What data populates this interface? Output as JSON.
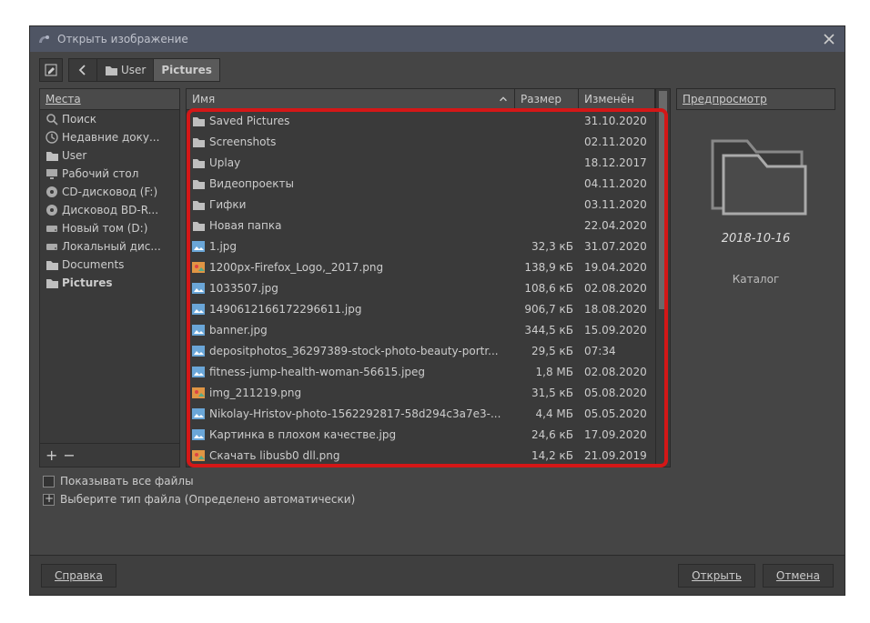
{
  "window": {
    "title": "Открыть изображение"
  },
  "breadcrumb": {
    "back": "<",
    "folder_icon": "folder",
    "segs": [
      "User",
      "Pictures"
    ]
  },
  "places": {
    "header": "Места",
    "items": [
      {
        "icon": "search",
        "label": "Поиск"
      },
      {
        "icon": "recent",
        "label": "Недавние доку..."
      },
      {
        "icon": "folder",
        "label": "User"
      },
      {
        "icon": "desktop",
        "label": "Рабочий стол"
      },
      {
        "icon": "cd",
        "label": "CD-дисковод (F:)"
      },
      {
        "icon": "cd",
        "label": "Дисковод BD-R..."
      },
      {
        "icon": "hdd",
        "label": "Новый том (D:)"
      },
      {
        "icon": "hdd",
        "label": "Локальный дис..."
      },
      {
        "icon": "folder",
        "label": "Documents"
      },
      {
        "icon": "folder",
        "label": "Pictures",
        "selected": true
      }
    ]
  },
  "file_header": {
    "name": "Имя",
    "size": "Размер",
    "modified": "Изменён"
  },
  "files": [
    {
      "icon": "folder",
      "name": "Saved Pictures",
      "size": "",
      "mod": "31.10.2020"
    },
    {
      "icon": "folder",
      "name": "Screenshots",
      "size": "",
      "mod": "02.11.2020"
    },
    {
      "icon": "folder",
      "name": "Uplay",
      "size": "",
      "mod": "18.12.2017"
    },
    {
      "icon": "folder",
      "name": "Видеопроекты",
      "size": "",
      "mod": "04.11.2020"
    },
    {
      "icon": "folder",
      "name": "Гифки",
      "size": "",
      "mod": "03.11.2020"
    },
    {
      "icon": "folder",
      "name": "Новая папка",
      "size": "",
      "mod": "22.04.2020"
    },
    {
      "icon": "image",
      "name": "1.jpg",
      "size": "32,3 кБ",
      "mod": "31.07.2020"
    },
    {
      "icon": "image-c",
      "name": "1200px-Firefox_Logo,_2017.png",
      "size": "138,9 кБ",
      "mod": "19.04.2020"
    },
    {
      "icon": "image",
      "name": "1033507.jpg",
      "size": "108,6 кБ",
      "mod": "02.08.2020"
    },
    {
      "icon": "image",
      "name": "1490612166172296611.jpg",
      "size": "906,7 кБ",
      "mod": "18.08.2020"
    },
    {
      "icon": "image",
      "name": "banner.jpg",
      "size": "344,5 кБ",
      "mod": "15.09.2020"
    },
    {
      "icon": "image",
      "name": "depositphotos_36297389-stock-photo-beauty-portr...",
      "size": "29,5 кБ",
      "mod": "07:34"
    },
    {
      "icon": "image",
      "name": "fitness-jump-health-woman-56615.jpeg",
      "size": "1,8 МБ",
      "mod": "02.08.2020"
    },
    {
      "icon": "image-c",
      "name": "img_211219.png",
      "size": "31,5 кБ",
      "mod": "05.08.2020"
    },
    {
      "icon": "image",
      "name": "Nikolay-Hristov-photo-1562292817-58d294c3a7e3-...",
      "size": "4,4 МБ",
      "mod": "05.05.2020"
    },
    {
      "icon": "image",
      "name": "Картинка в плохом качестве.jpg",
      "size": "24,6 кБ",
      "mod": "17.09.2020"
    },
    {
      "icon": "image-c",
      "name": "Скачать libusb0 dll.png",
      "size": "14,2 кБ",
      "mod": "21.09.2019"
    }
  ],
  "preview": {
    "header": "Предпросмотр",
    "name": "2018-10-16",
    "type": "Каталог"
  },
  "options": {
    "show_all": "Показывать все файлы",
    "file_type": "Выберите тип файла (Определено автоматически)"
  },
  "buttons": {
    "help": "Справка",
    "open": "Открыть",
    "cancel": "Отмена"
  }
}
